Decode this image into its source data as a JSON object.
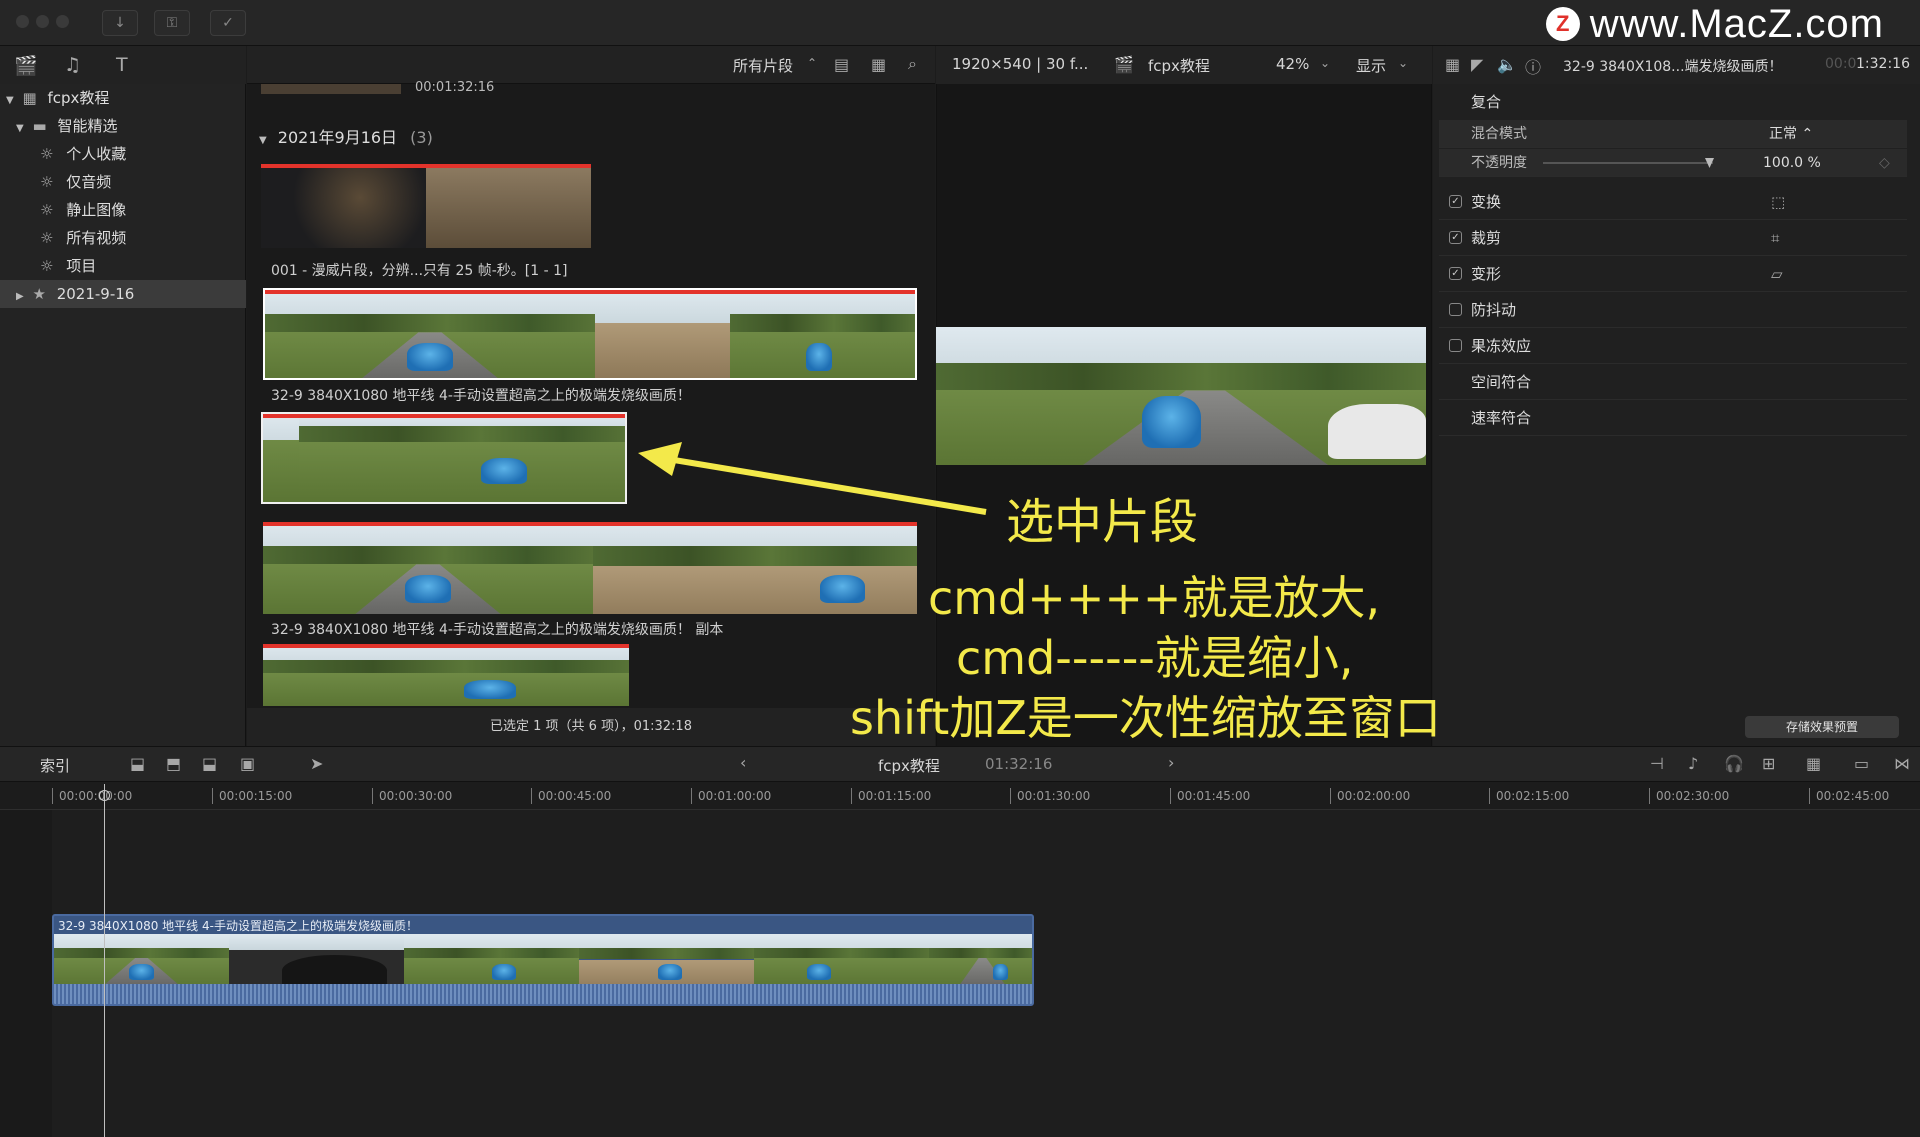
{
  "watermark": {
    "logo": "Z",
    "text": "www.MacZ.com"
  },
  "library": {
    "title": "fcpx教程",
    "smart_collections": "智能精选",
    "items": [
      "个人收藏",
      "仅音频",
      "静止图像",
      "所有视频",
      "项目"
    ],
    "event": "2021-9-16"
  },
  "browser": {
    "filter": "所有片段",
    "partial_time": "00:01:32:16",
    "group_title": "2021年9月16日",
    "group_count": "(3)",
    "clips": [
      {
        "caption": "001 - 漫威片段，分辨...只有 25 帧-秒。[1 - 1]"
      },
      {
        "caption": "32-9 3840X1080 地平线 4-手动设置超高之上的极端发烧级画质！"
      },
      {
        "caption": ""
      },
      {
        "caption": "32-9 3840X1080 地平线 4-手动设置超高之上的极端发烧级画质！  副本"
      }
    ],
    "footer": "已选定 1 项（共 6 项），01:32:18"
  },
  "viewer": {
    "format": "1920×540 | 30 f...",
    "project": "fcpx教程",
    "zoom": "42%",
    "display": "显示"
  },
  "inspector": {
    "clip_name": "32-9 3840X108...端发烧级画质！",
    "timecode_dim": "00:0",
    "timecode": "1:32:16",
    "section": "复合",
    "blend_label": "混合模式",
    "blend_value": "正常 ⌃",
    "opacity_label": "不透明度",
    "opacity_value": "100.0  %",
    "rows": [
      {
        "label": "变换",
        "checked": true
      },
      {
        "label": "裁剪",
        "checked": true
      },
      {
        "label": "变形",
        "checked": true
      },
      {
        "label": "防抖动",
        "checked": false
      },
      {
        "label": "果冻效应",
        "checked": false
      },
      {
        "label": "空间符合",
        "checked": null
      },
      {
        "label": "速率符合",
        "checked": null
      }
    ],
    "save_preset": "存储效果预置"
  },
  "timeline": {
    "index": "索引",
    "project": "fcpx教程",
    "duration": "01:32:16",
    "ticks": [
      "00:00:00:00",
      "00:00:15:00",
      "00:00:30:00",
      "00:00:45:00",
      "00:01:00:00",
      "00:01:15:00",
      "00:01:30:00",
      "00:01:45:00",
      "00:02:00:00",
      "00:02:15:00",
      "00:02:30:00",
      "00:02:45:00"
    ],
    "clip_title": "32-9 3840X1080 地平线 4-手动设置超高之上的极端发烧级画质！"
  },
  "annotations": {
    "select": "选中片段",
    "line1": "cmd++++就是放大,",
    "line2": "cmd------就是缩小,",
    "line3": "shift加Z是一次性缩放至窗口"
  },
  "colors": {
    "annotation": "#f3e94a",
    "clip": "#3a5683",
    "marker": "#e3332b"
  }
}
